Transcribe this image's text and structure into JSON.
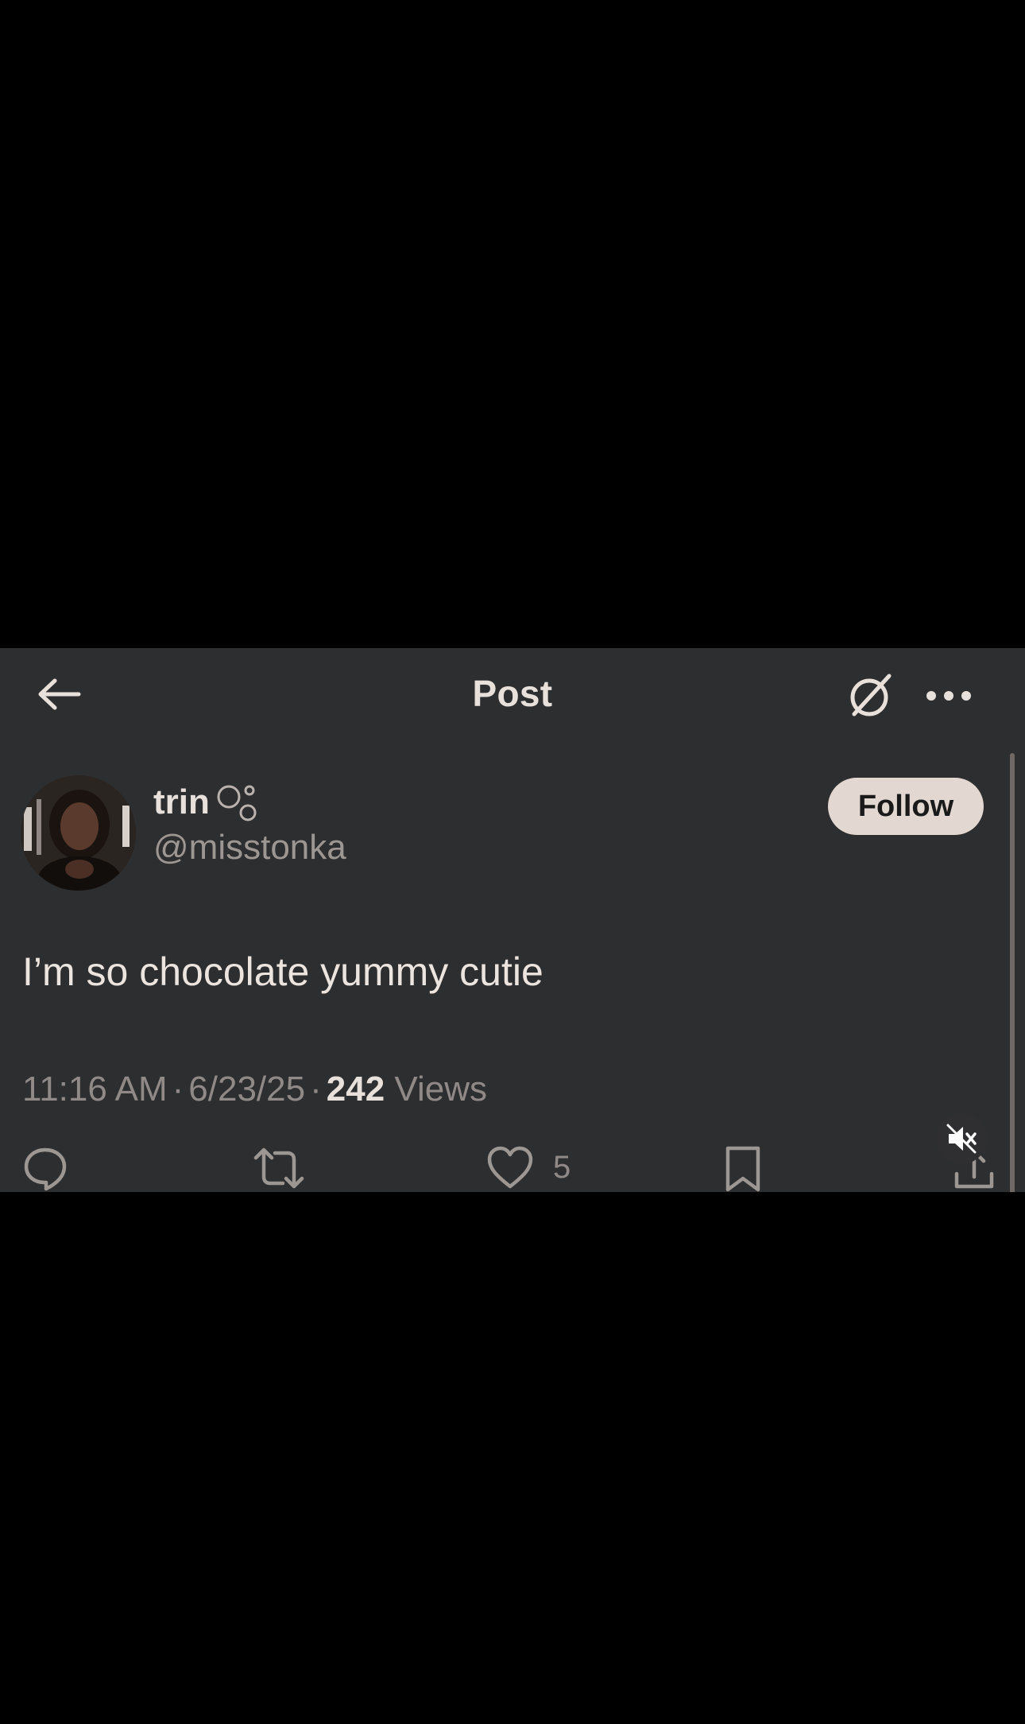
{
  "header": {
    "title": "Post",
    "back_icon": "arrow-left-icon",
    "grok_icon": "slashed-circle-icon",
    "more_icon": "more-horizontal-icon"
  },
  "author": {
    "display_name": "trin",
    "name_emoji": "bubbles-emoji",
    "handle": "@misstonka",
    "follow_label": "Follow"
  },
  "post": {
    "text": "I’m so chocolate yummy cutie",
    "time": "11:16 AM",
    "separator": "·",
    "date": "6/23/25",
    "views_count": "242",
    "views_label": "Views"
  },
  "actions": {
    "reply_icon": "reply-icon",
    "repost_icon": "repost-icon",
    "like_icon": "heart-icon",
    "like_count": "5",
    "bookmark_icon": "bookmark-icon",
    "share_icon": "share-icon"
  },
  "video_overlay": {
    "mute_icon": "speaker-muted-icon"
  },
  "colors": {
    "page_background": "#000000",
    "card_background": "#2d2e30",
    "primary_text": "#e8e0db",
    "secondary_text": "#8f8a88",
    "follow_button": "#e3d7d1"
  }
}
